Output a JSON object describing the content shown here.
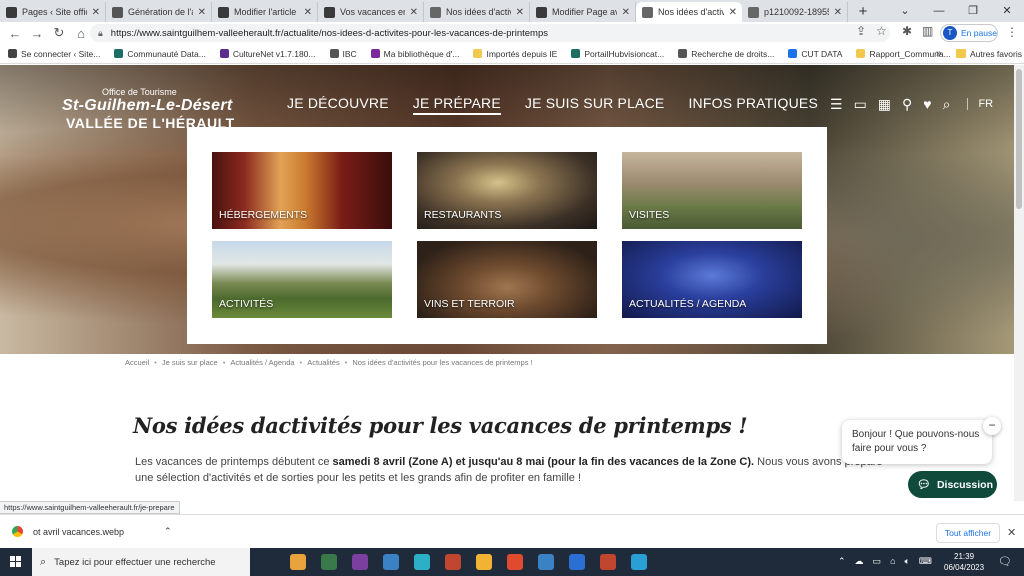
{
  "browser": {
    "tabs": [
      {
        "title": "Pages ‹ Site officiel",
        "active": false,
        "color": "#3a3a3a"
      },
      {
        "title": "Génération de l'ap",
        "active": false,
        "color": "#555555"
      },
      {
        "title": "Modifier l'article ‹ S",
        "active": false,
        "color": "#3a3a3a"
      },
      {
        "title": "Vos vacances en va",
        "active": false,
        "color": "#3a3a3a"
      },
      {
        "title": "Nos idées d'activit",
        "active": false,
        "color": "#666666"
      },
      {
        "title": "Modifier Page ave",
        "active": false,
        "color": "#3a3a3a"
      },
      {
        "title": "Nos idées d'activit",
        "active": true,
        "color": "#666666"
      },
      {
        "title": "p1210092-18955.w",
        "active": false,
        "color": "#666666"
      }
    ],
    "new_tab_label": "+",
    "url": "https://www.saintguilhem-valleeherault.fr/actualite/nos-idees-d-activites-pour-les-vacances-de-printemps",
    "profile_initial": "T",
    "profile_status": "En pause",
    "bookmarks": [
      {
        "label": "Se connecter ‹ Site...",
        "color": "#444444"
      },
      {
        "label": "Communauté Data...",
        "color": "#1b6e64"
      },
      {
        "label": "CultureNet v1.7.180...",
        "color": "#5b2d8e"
      },
      {
        "label": "IBC",
        "color": "#555555"
      },
      {
        "label": "Ma bibliothèque d'...",
        "color": "#7b2a9c"
      },
      {
        "label": "Importés depuis IE",
        "color": "#f2c94c"
      },
      {
        "label": "PortailHubvisioncat...",
        "color": "#1b6e64"
      },
      {
        "label": "Recherche de droits...",
        "color": "#555555"
      },
      {
        "label": "CUT DATA",
        "color": "#1a73e8"
      },
      {
        "label": "Rapport_Communa...",
        "color": "#f2c94c"
      }
    ],
    "bookmarks_more": "»",
    "bookmarks_other": "Autres favoris"
  },
  "site": {
    "logo": {
      "line1": "Office de Tourisme",
      "line2": "St-Guilhem-Le-Désert",
      "line3": "VALLÉE DE L'HÉRAULT"
    },
    "nav": [
      "JE DÉCOUVRE",
      "JE PRÉPARE",
      "JE SUIS SUR PLACE",
      "INFOS PRATIQUES"
    ],
    "nav_active_index": 1,
    "lang": "FR",
    "dropdown_cards": [
      {
        "label": "HÉBERGEMENTS"
      },
      {
        "label": "RESTAURANTS"
      },
      {
        "label": "VISITES"
      },
      {
        "label": "ACTIVITÉS"
      },
      {
        "label": "VINS ET TERROIR"
      },
      {
        "label": "ACTUALITÉS / AGENDA"
      }
    ],
    "breadcrumb": [
      "Accueil",
      "Je suis sur place",
      "Actualités / Agenda",
      "Actualités",
      "Nos idées d'activités pour les vacances de printemps !"
    ],
    "breadcrumb_sep": "•",
    "title": "Nos idées dactivités pour les vacances de printemps !",
    "intro": {
      "t1": "Les vacances de printemps débutent ce ",
      "b1": "samedi 8 avril (Zone A)",
      "t2": "  ",
      "b2": "et jusqu'au 8 mai (pour la fin des vacances de la Zone C).",
      "t3": " Nous vous avons préparé une sélection d'activités et de sorties pour les petits et les grands afin de profiter en famille !"
    },
    "chat": {
      "bubble": "Bonjour ! Que pouvons-nous faire pour vous ?",
      "minimize": "−",
      "button": "Discussion"
    }
  },
  "status_url": "https://www.saintguilhem-valleeherault.fr/je-prepare",
  "download": {
    "filename": "ot avril vacances.webp",
    "show_all": "Tout afficher",
    "close": "✕"
  },
  "taskbar": {
    "search_placeholder": "Tapez ici pour effectuer une recherche",
    "time": "21:39",
    "date": "06/04/2023",
    "apps": [
      "#e8a33d",
      "#3a7a4a",
      "#7b3fa0",
      "#3b82c4",
      "#2bb0c8",
      "#c0462f",
      "#f2b233",
      "#e04a2f",
      "#3b82c4",
      "#2a6fd1",
      "#c0462f",
      "#2a9fd6"
    ]
  }
}
